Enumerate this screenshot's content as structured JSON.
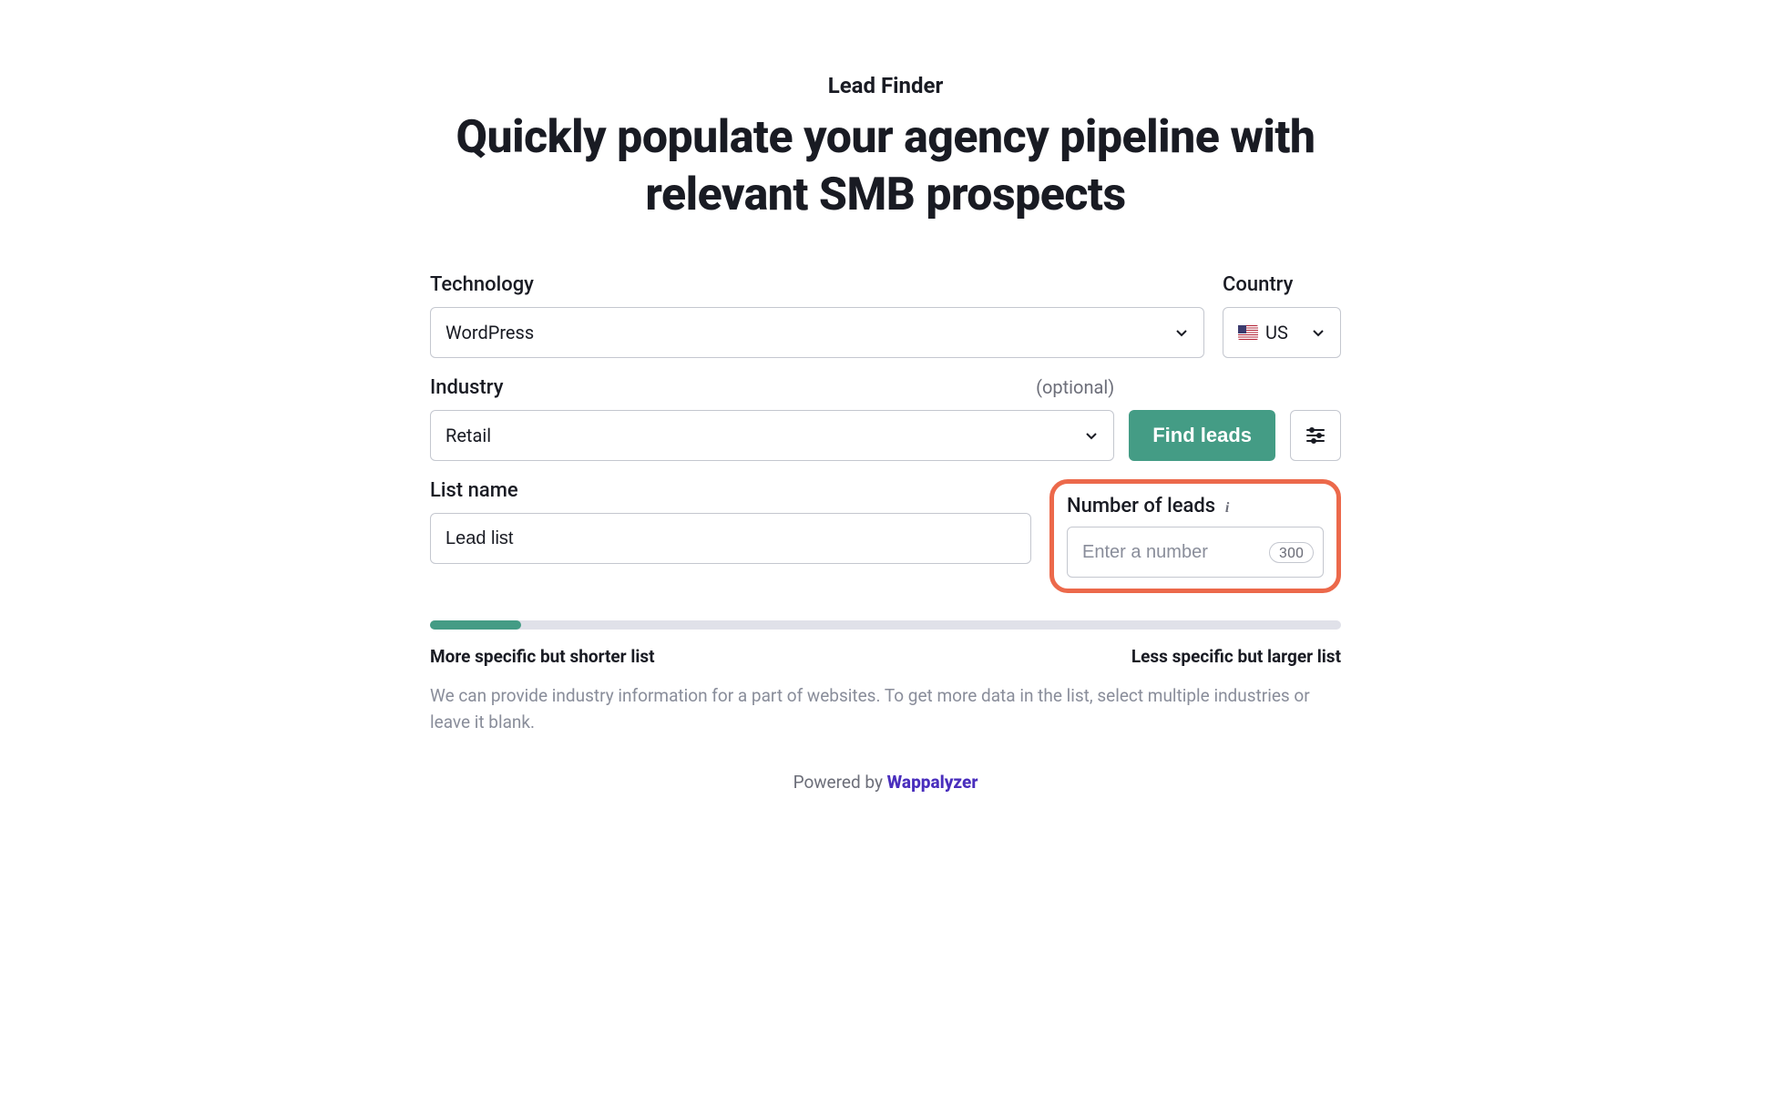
{
  "header": {
    "subtitle": "Lead Finder",
    "title": "Quickly populate your agency pipeline with relevant SMB prospects"
  },
  "form": {
    "technology": {
      "label": "Technology",
      "value": "WordPress"
    },
    "country": {
      "label": "Country",
      "value": "US"
    },
    "industry": {
      "label": "Industry",
      "optional_text": "(optional)",
      "value": "Retail"
    },
    "find_leads_label": "Find leads",
    "list_name": {
      "label": "List name",
      "value": "Lead list"
    },
    "number_of_leads": {
      "label": "Number of leads",
      "placeholder": "Enter a number",
      "badge": "300"
    }
  },
  "slider": {
    "fill_percent": 10,
    "left_label": "More specific but shorter list",
    "right_label": "Less specific but larger list"
  },
  "help_text": "We can provide industry information for a part of websites. To get more data in the list, select multiple industries or leave it blank.",
  "footer": {
    "powered_by_prefix": "Powered by ",
    "brand": "Wappalyzer"
  }
}
